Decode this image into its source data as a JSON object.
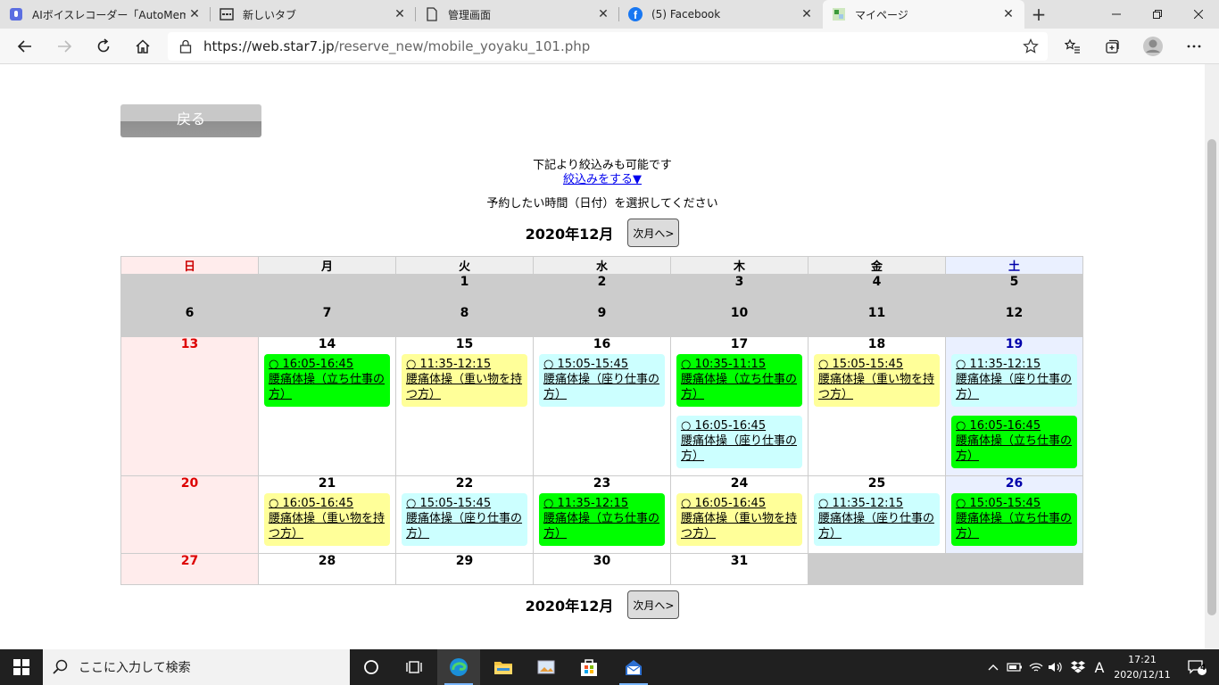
{
  "browser": {
    "tabs": [
      {
        "title": "AIボイスレコーダー「AutoMemo」",
        "icon": "automemo-icon",
        "active": false
      },
      {
        "title": "新しいタブ",
        "icon": "newtab-icon",
        "active": false
      },
      {
        "title": "管理画面",
        "icon": "page-icon",
        "active": false
      },
      {
        "title": "(5) Facebook",
        "icon": "facebook-icon",
        "active": false
      },
      {
        "title": "マイページ",
        "icon": "site-icon",
        "active": true
      }
    ],
    "url_host": "https://web.star7.jp",
    "url_path": "/reserve_new/mobile_yoyaku_101.php"
  },
  "page": {
    "back_label": "戻る",
    "filter_hint": "下記より絞込みも可能です",
    "filter_link": "絞込みをする▼",
    "instruction": "予約したい時間（日付）を選択してください",
    "month_label": "2020年12月",
    "next_month_label": "次月へ>"
  },
  "calendar": {
    "weekdays": [
      "日",
      "月",
      "火",
      "水",
      "木",
      "金",
      "土"
    ],
    "colors": {
      "green": "#00ff00",
      "yellow": "#ffff99",
      "cyan": "#ccffff",
      "sunday_bg": "#ffecec",
      "saturday_bg": "#eaf0ff",
      "past_bg": "#cccccc"
    },
    "weeks": [
      [
        {
          "day": ""
        },
        {
          "day": ""
        },
        {
          "day": "1"
        },
        {
          "day": "2"
        },
        {
          "day": "3"
        },
        {
          "day": "4"
        },
        {
          "day": "5"
        }
      ],
      [
        {
          "day": "6"
        },
        {
          "day": "7"
        },
        {
          "day": "8"
        },
        {
          "day": "9"
        },
        {
          "day": "10"
        },
        {
          "day": "11"
        },
        {
          "day": "12"
        }
      ],
      [
        {
          "day": "13",
          "slots": []
        },
        {
          "day": "14",
          "slots": [
            {
              "time": "○ 16:05-16:45",
              "title": "腰痛体操（立ち仕事の方）",
              "color": "green"
            }
          ]
        },
        {
          "day": "15",
          "slots": [
            {
              "time": "○ 11:35-12:15",
              "title": "腰痛体操（重い物を持つ方）",
              "color": "yellow"
            }
          ]
        },
        {
          "day": "16",
          "slots": [
            {
              "time": "○ 15:05-15:45",
              "title": "腰痛体操（座り仕事の方）",
              "color": "cyan"
            }
          ]
        },
        {
          "day": "17",
          "slots": [
            {
              "time": "○ 10:35-11:15",
              "title": "腰痛体操（立ち仕事の方）",
              "color": "green"
            },
            {
              "time": "○ 16:05-16:45",
              "title": "腰痛体操（座り仕事の方）",
              "color": "cyan"
            }
          ]
        },
        {
          "day": "18",
          "slots": [
            {
              "time": "○ 15:05-15:45",
              "title": "腰痛体操（重い物を持つ方）",
              "color": "yellow"
            }
          ]
        },
        {
          "day": "19",
          "slots": [
            {
              "time": "○ 11:35-12:15",
              "title": "腰痛体操（座り仕事の方）",
              "color": "cyan"
            },
            {
              "time": "○ 16:05-16:45",
              "title": "腰痛体操（立ち仕事の方）",
              "color": "green"
            }
          ]
        }
      ],
      [
        {
          "day": "20",
          "slots": []
        },
        {
          "day": "21",
          "slots": [
            {
              "time": "○ 16:05-16:45",
              "title": "腰痛体操（重い物を持つ方）",
              "color": "yellow"
            }
          ]
        },
        {
          "day": "22",
          "slots": [
            {
              "time": "○ 15:05-15:45",
              "title": "腰痛体操（座り仕事の方）",
              "color": "cyan"
            }
          ]
        },
        {
          "day": "23",
          "slots": [
            {
              "time": "○ 11:35-12:15",
              "title": "腰痛体操（立ち仕事の方）",
              "color": "green"
            }
          ]
        },
        {
          "day": "24",
          "slots": [
            {
              "time": "○ 16:05-16:45",
              "title": "腰痛体操（重い物を持つ方）",
              "color": "yellow"
            }
          ]
        },
        {
          "day": "25",
          "slots": [
            {
              "time": "○ 11:35-12:15",
              "title": "腰痛体操（座り仕事の方）",
              "color": "cyan"
            }
          ]
        },
        {
          "day": "26",
          "slots": [
            {
              "time": "○ 15:05-15:45",
              "title": "腰痛体操（立ち仕事の方）",
              "color": "green"
            }
          ]
        }
      ],
      [
        {
          "day": "27",
          "slots": []
        },
        {
          "day": "28",
          "slots": []
        },
        {
          "day": "29",
          "slots": []
        },
        {
          "day": "30",
          "slots": []
        },
        {
          "day": "31",
          "slots": []
        },
        {
          "day": ""
        },
        {
          "day": ""
        }
      ]
    ]
  },
  "taskbar": {
    "search_placeholder": "ここに入力して検索",
    "ime": "A",
    "time": "17:21",
    "date": "2020/12/11",
    "notifications": "4"
  }
}
